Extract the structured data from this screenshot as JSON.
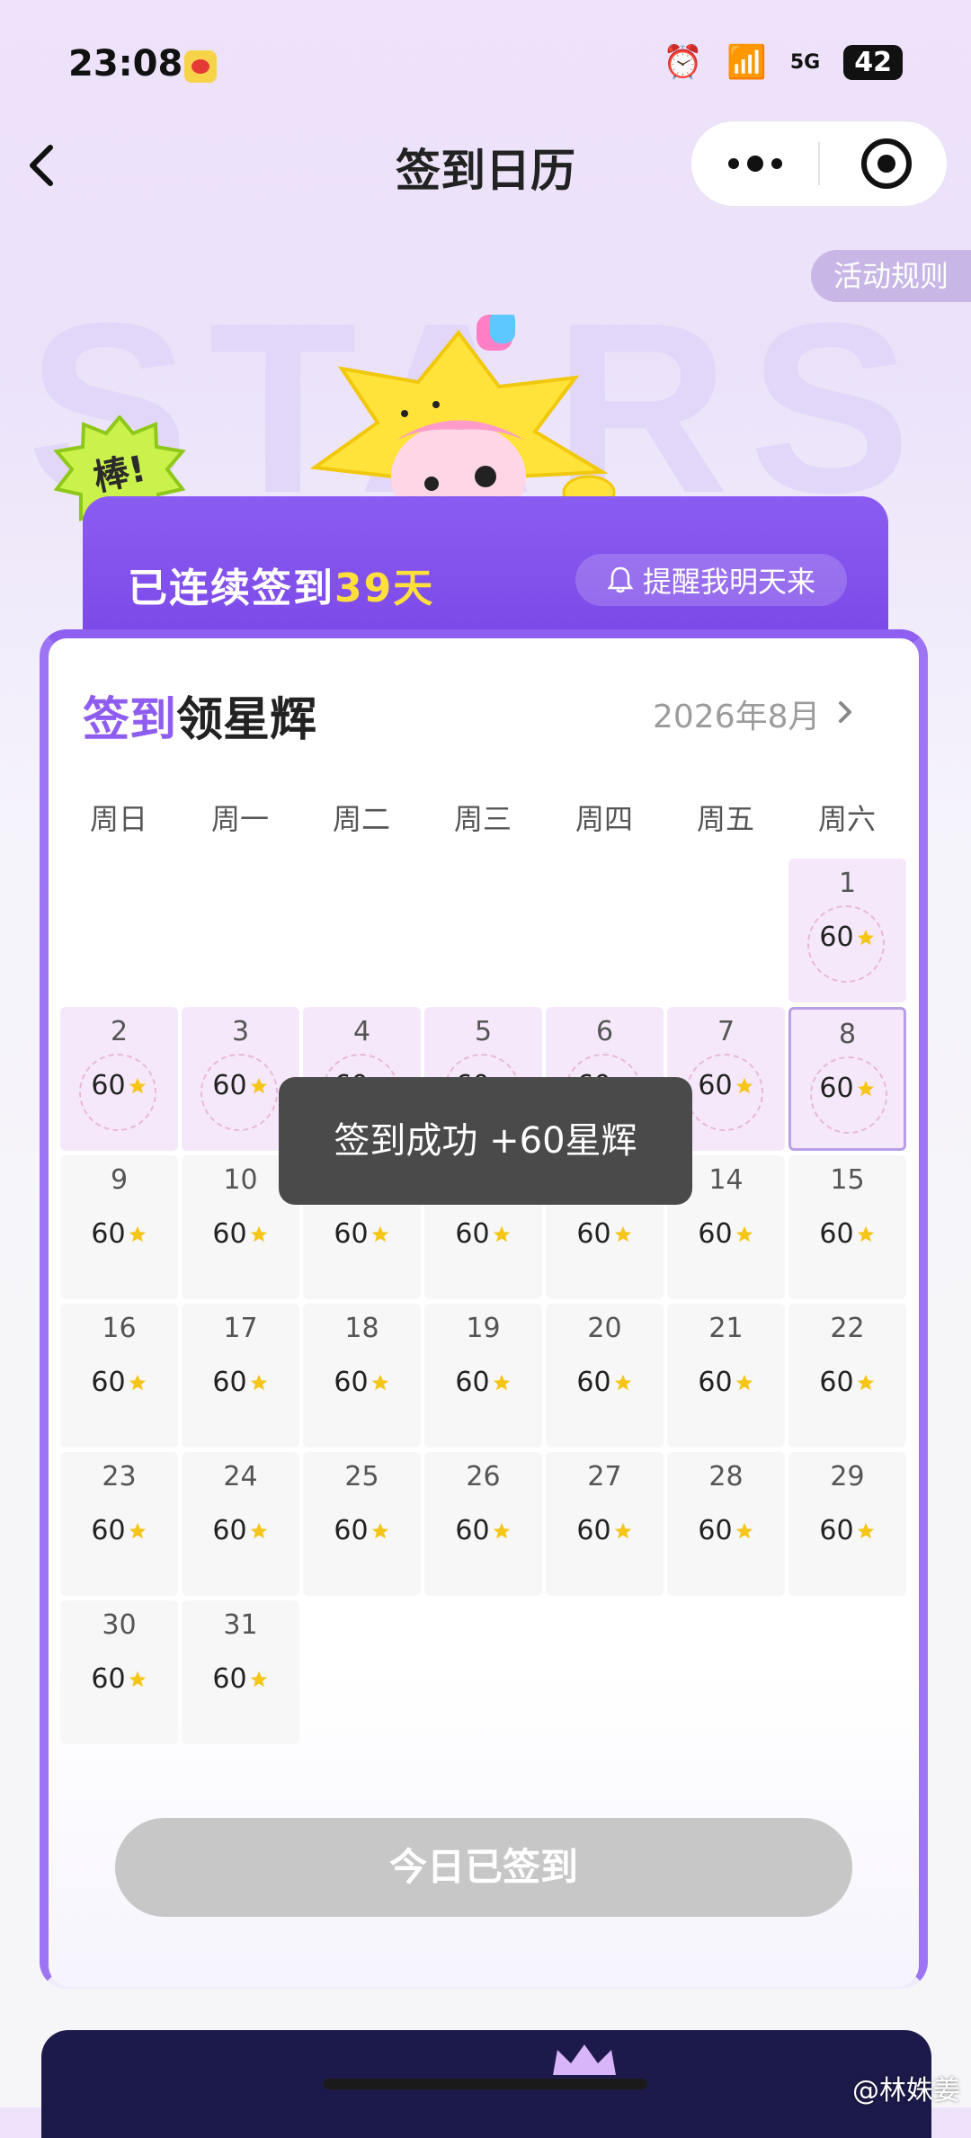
{
  "status": {
    "time": "23:08",
    "network": "5G",
    "battery": "42"
  },
  "nav": {
    "title": "签到日历"
  },
  "rules_label": "活动规则",
  "watermark_bg": "STARS",
  "badge_text": "棒!",
  "streak": {
    "prefix": "已连续签到",
    "days": "39天"
  },
  "remind_label": "提醒我明天来",
  "card": {
    "title_accent": "签到",
    "title_rest": "领星辉",
    "month": "2026年8月"
  },
  "weekdays": [
    "周日",
    "周一",
    "周二",
    "周三",
    "周四",
    "周五",
    "周六"
  ],
  "reward_value": "60",
  "calendar": {
    "first_weekday_index": 6,
    "days_in_month": 31,
    "signed_days": [
      1,
      2,
      3,
      4,
      5,
      6,
      7,
      8
    ],
    "today": 8
  },
  "toast": "签到成功 +60星辉",
  "button_label": "今日已签到",
  "watermark_text": "@林姝姜",
  "colors": {
    "accent": "#8f5cf0",
    "streak_highlight": "#ffe03b",
    "star": "#f5c518"
  }
}
